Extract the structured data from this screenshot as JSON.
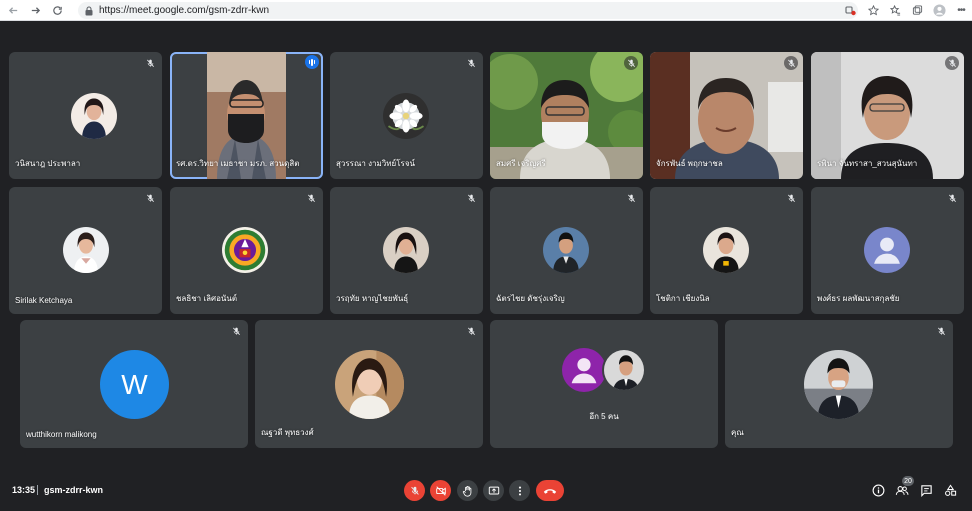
{
  "browser": {
    "url": "https://meet.google.com/gsm-zdrr-kwn"
  },
  "tiles": [
    {
      "name": "วนิสนาฎ ประพาลา",
      "kind": "avatar-photo"
    },
    {
      "name": "รศ.ดร.วิทยา เมธาชา มรภ. สวนดุสิต",
      "kind": "video",
      "speaking": true
    },
    {
      "name": "สุวรรณา งามวิทย์โรจน์",
      "kind": "avatar-flower"
    },
    {
      "name": "สมศรี เจริญศรี",
      "kind": "video"
    },
    {
      "name": "จักรพันธ์ พฤกษาชล",
      "kind": "video"
    },
    {
      "name": "รพินา จันทราสา_สวนสุนันทา",
      "kind": "video"
    },
    {
      "name": "Sirilak Ketchaya",
      "kind": "avatar-photo"
    },
    {
      "name": "ชลธิชา เลิศอนันต์",
      "kind": "avatar-emblem"
    },
    {
      "name": "วรฤทัย หาญไชยพันธุ์",
      "kind": "avatar-photo"
    },
    {
      "name": "ฉัตรไชย ดัชรุ่งเจริญ",
      "kind": "avatar-photo"
    },
    {
      "name": "โชติกา เชียงนิล",
      "kind": "avatar-photo"
    },
    {
      "name": "พงศ์ธร ผลพัฒนาสกุลชัย",
      "kind": "avatar-default"
    },
    {
      "name": "wutthikorn malikong",
      "kind": "avatar-letter",
      "letter": "W"
    },
    {
      "name": "ณฐวดี พุทธวงศ์",
      "kind": "avatar-photo"
    },
    {
      "name": "อีก 5 คน",
      "kind": "others"
    },
    {
      "name": "คุณ",
      "kind": "avatar-photo"
    }
  ],
  "bottom_bar": {
    "time": "13:35",
    "meeting_code": "gsm-zdrr-kwn",
    "participants_count": "20"
  },
  "colors": {
    "tile_bg": "#3c4043",
    "page_bg": "#202124",
    "accent_blue": "#1a73e8",
    "danger_red": "#ea4335",
    "letter_avatar": "#1e88e5",
    "default_avatar": "#7986cb",
    "others_avatar": "#8e24aa"
  }
}
